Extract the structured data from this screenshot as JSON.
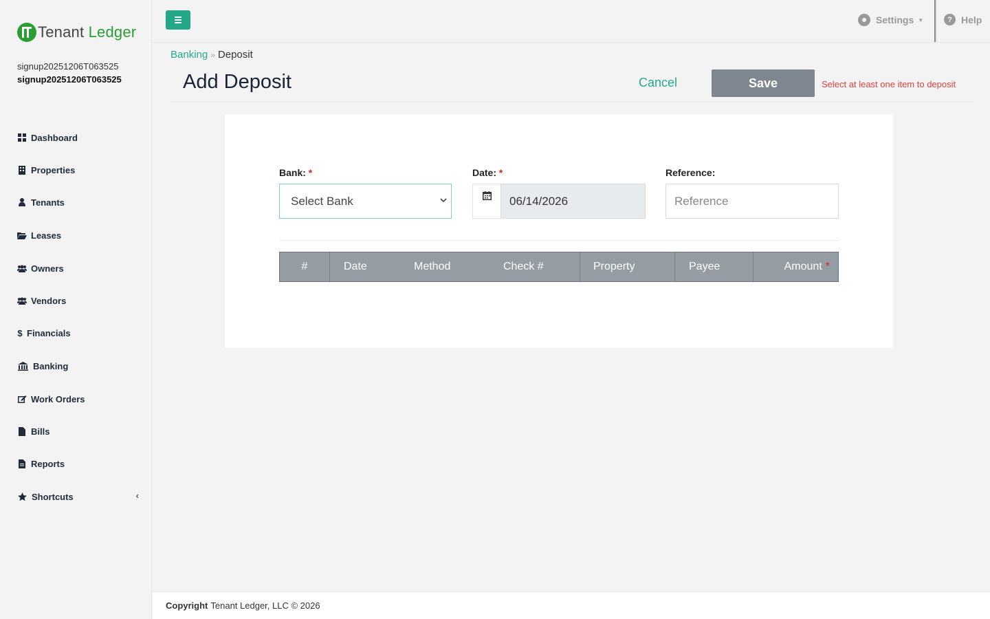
{
  "brand": {
    "name_a": "Tenant",
    "name_b": "Ledger"
  },
  "user": {
    "line1": "signup20251206T063525",
    "line2": "signup20251206T063525"
  },
  "sidebar": {
    "items": [
      {
        "label": "Dashboard",
        "icon": "dashboard-icon"
      },
      {
        "label": "Properties",
        "icon": "building-icon"
      },
      {
        "label": "Tenants",
        "icon": "user-icon"
      },
      {
        "label": "Leases",
        "icon": "folder-open-icon"
      },
      {
        "label": "Owners",
        "icon": "users-icon"
      },
      {
        "label": "Vendors",
        "icon": "users-icon"
      },
      {
        "label": "Financials",
        "icon": "dollar-icon"
      },
      {
        "label": "Banking",
        "icon": "bank-icon"
      },
      {
        "label": "Work Orders",
        "icon": "edit-icon"
      },
      {
        "label": "Bills",
        "icon": "file-icon"
      },
      {
        "label": "Reports",
        "icon": "file-text-icon"
      },
      {
        "label": "Shortcuts",
        "icon": "star-icon"
      }
    ]
  },
  "topbar": {
    "settings_label": "Settings",
    "help_label": "Help"
  },
  "breadcrumb": {
    "parent": "Banking",
    "current": "Deposit"
  },
  "page": {
    "title": "Add Deposit",
    "cancel_label": "Cancel",
    "save_label": "Save",
    "warning": "Select at least one item to deposit"
  },
  "form": {
    "bank_label": "Bank:",
    "bank_value": "Select Bank",
    "date_label": "Date:",
    "date_value": "06/14/2026",
    "reference_label": "Reference:",
    "reference_placeholder": "Reference",
    "required_mark": "*"
  },
  "table": {
    "columns": [
      "#",
      "Date",
      "Method",
      "Check #",
      "Property",
      "Payee",
      "Amount"
    ]
  },
  "footer": {
    "bold": "Copyright",
    "text": "Tenant Ledger, LLC © 2026"
  },
  "colors": {
    "accent": "#23a98a",
    "brand_green": "#2a9d34",
    "warning": "#e04040",
    "table_header": "#949ca4"
  }
}
